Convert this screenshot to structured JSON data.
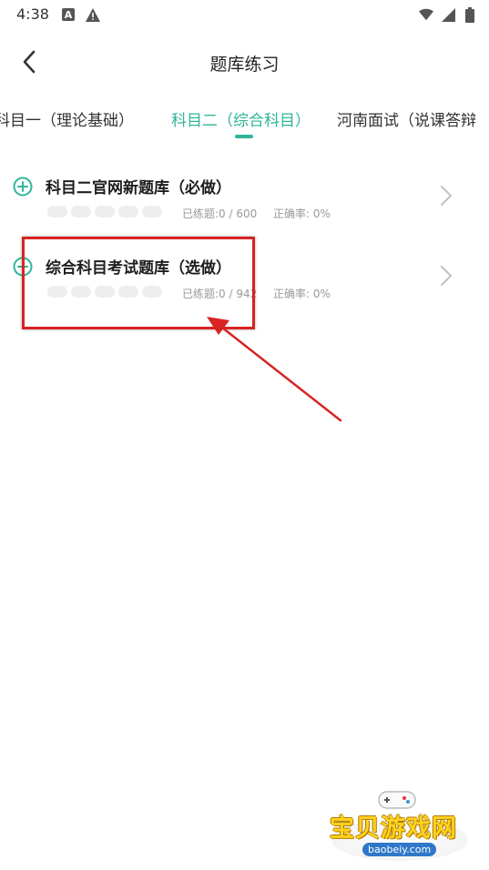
{
  "status_bar": {
    "time": "4:38",
    "a_badge": "A"
  },
  "header": {
    "title": "题库练习"
  },
  "tabs": [
    {
      "label": "科目一（理论基础）"
    },
    {
      "label": "科目二（综合科目）"
    },
    {
      "label": "河南面试（说课答辩"
    }
  ],
  "items": [
    {
      "title": "科目二官网新题库（必做）",
      "done": "已练题:0 / 600",
      "rate": "正确率: 0%"
    },
    {
      "title": "综合科目考试题库（选做）",
      "done": "已练题:0 / 942",
      "rate": "正确率: 0%"
    }
  ],
  "watermark": {
    "brand": "宝贝游戏网",
    "url": "baobeiy.com"
  },
  "colors": {
    "accent": "#2fb59a",
    "annotation": "#d82424"
  }
}
